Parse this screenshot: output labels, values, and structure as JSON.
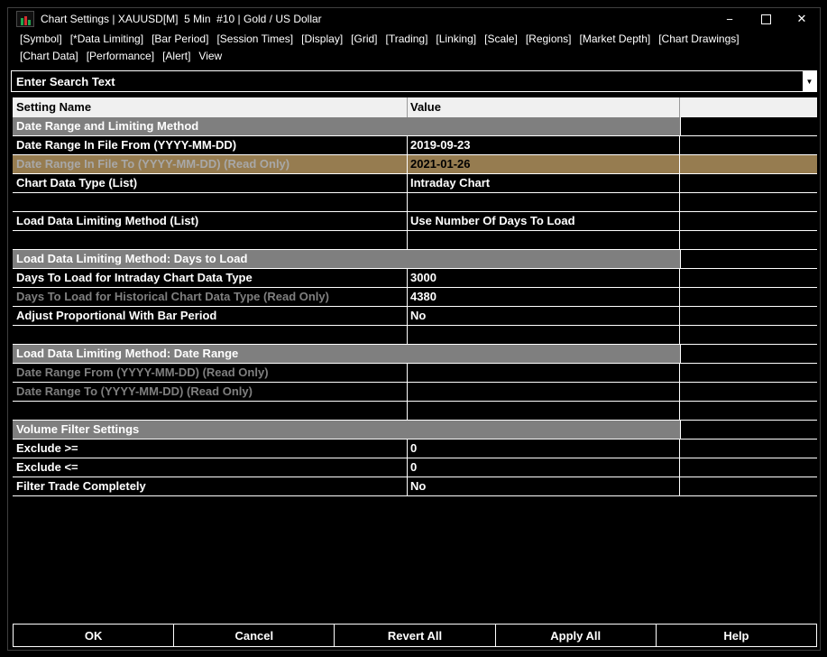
{
  "window": {
    "title": "Chart Settings | XAUUSD[M]  5 Min  #10 | Gold / US Dollar",
    "controls": {
      "minimize": "−",
      "close": "✕"
    }
  },
  "menu": {
    "row1": [
      {
        "label": "[Symbol]"
      },
      {
        "label": "[*Data Limiting]"
      },
      {
        "label": "[Bar Period]"
      },
      {
        "label": "[Session Times]"
      },
      {
        "label": "[Display]"
      },
      {
        "label": "[Grid]"
      },
      {
        "label": "[Trading]"
      },
      {
        "label": "[Linking]"
      },
      {
        "label": "[Scale]"
      },
      {
        "label": "[Regions]"
      },
      {
        "label": "[Market Depth]"
      },
      {
        "label": "[Chart Drawings]"
      }
    ],
    "row2": [
      {
        "label": "[Chart Data]"
      },
      {
        "label": "[Performance]"
      },
      {
        "label": "[Alert]"
      },
      {
        "label": "View"
      }
    ]
  },
  "search": {
    "value": "Enter Search Text"
  },
  "icons": {
    "combo_arrow": "▼"
  },
  "table": {
    "headers": {
      "name": "Setting Name",
      "value": "Value"
    },
    "rows": [
      {
        "type": "section",
        "name": "Date Range and Limiting Method"
      },
      {
        "type": "setting",
        "name": "Date Range In File From (YYYY-MM-DD)",
        "value": "2019-09-23"
      },
      {
        "type": "setting",
        "name": "Date Range In File To (YYYY-MM-DD) (Read Only)",
        "value": "2021-01-26",
        "readonly": true,
        "selected": true
      },
      {
        "type": "setting",
        "name": "Chart Data Type (List)",
        "value": "Intraday Chart"
      },
      {
        "type": "spacer"
      },
      {
        "type": "setting",
        "name": "Load Data Limiting Method (List)",
        "value": "Use Number Of Days To Load"
      },
      {
        "type": "spacer"
      },
      {
        "type": "section",
        "name": "Load Data Limiting Method: Days to Load"
      },
      {
        "type": "setting",
        "name": "Days To Load for Intraday Chart Data Type",
        "value": "3000"
      },
      {
        "type": "setting",
        "name": "Days To Load for Historical Chart Data Type (Read Only)",
        "value": "4380",
        "readonly": true
      },
      {
        "type": "setting",
        "name": "Adjust Proportional With Bar Period",
        "value": "No"
      },
      {
        "type": "spacer"
      },
      {
        "type": "section",
        "name": "Load Data Limiting Method: Date Range"
      },
      {
        "type": "setting",
        "name": "Date Range From (YYYY-MM-DD) (Read Only)",
        "value": "",
        "readonly": true
      },
      {
        "type": "setting",
        "name": "Date Range To (YYYY-MM-DD) (Read Only)",
        "value": "",
        "readonly": true
      },
      {
        "type": "spacer"
      },
      {
        "type": "section",
        "name": "Volume Filter Settings"
      },
      {
        "type": "setting",
        "name": "Exclude >=",
        "value": "0"
      },
      {
        "type": "setting",
        "name": "Exclude <=",
        "value": "0"
      },
      {
        "type": "setting",
        "name": "Filter Trade Completely",
        "value": "No"
      }
    ]
  },
  "buttons": [
    {
      "label": "OK"
    },
    {
      "label": "Cancel"
    },
    {
      "label": "Revert All"
    },
    {
      "label": "Apply All"
    },
    {
      "label": "Help"
    }
  ],
  "colors": {
    "selected_row_bg": "#967C50",
    "selected_name_text": "#a8a8a8",
    "section_bg": "#7f7f7f",
    "readonly_text": "#7f7f7f",
    "header_bg": "#f0f0f0",
    "grid_line": "#ffffff",
    "icon_green": "#21a84e",
    "icon_red": "#d32f2f"
  }
}
